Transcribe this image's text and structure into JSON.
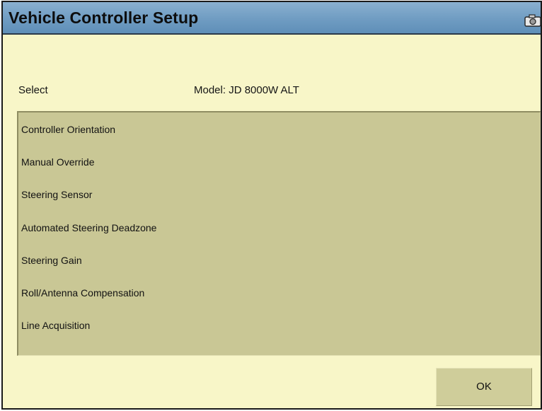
{
  "window": {
    "title": "Vehicle Controller Setup",
    "title_icon": "camera-icon"
  },
  "header": {
    "select_label": "Select",
    "model_text": "Model: JD 8000W ALT"
  },
  "list": {
    "items": [
      {
        "label": "Controller Orientation"
      },
      {
        "label": "Manual Override"
      },
      {
        "label": "Steering Sensor"
      },
      {
        "label": "Automated Steering Deadzone"
      },
      {
        "label": "Steering Gain"
      },
      {
        "label": "Roll/Antenna Compensation"
      },
      {
        "label": "Line Acquisition"
      }
    ]
  },
  "footer": {
    "ok_label": "OK"
  },
  "colors": {
    "background": "#f8f6c8",
    "title_bar": "#6f9cc2",
    "list_background": "#c9c795",
    "button_background": "#cfcd9a"
  }
}
